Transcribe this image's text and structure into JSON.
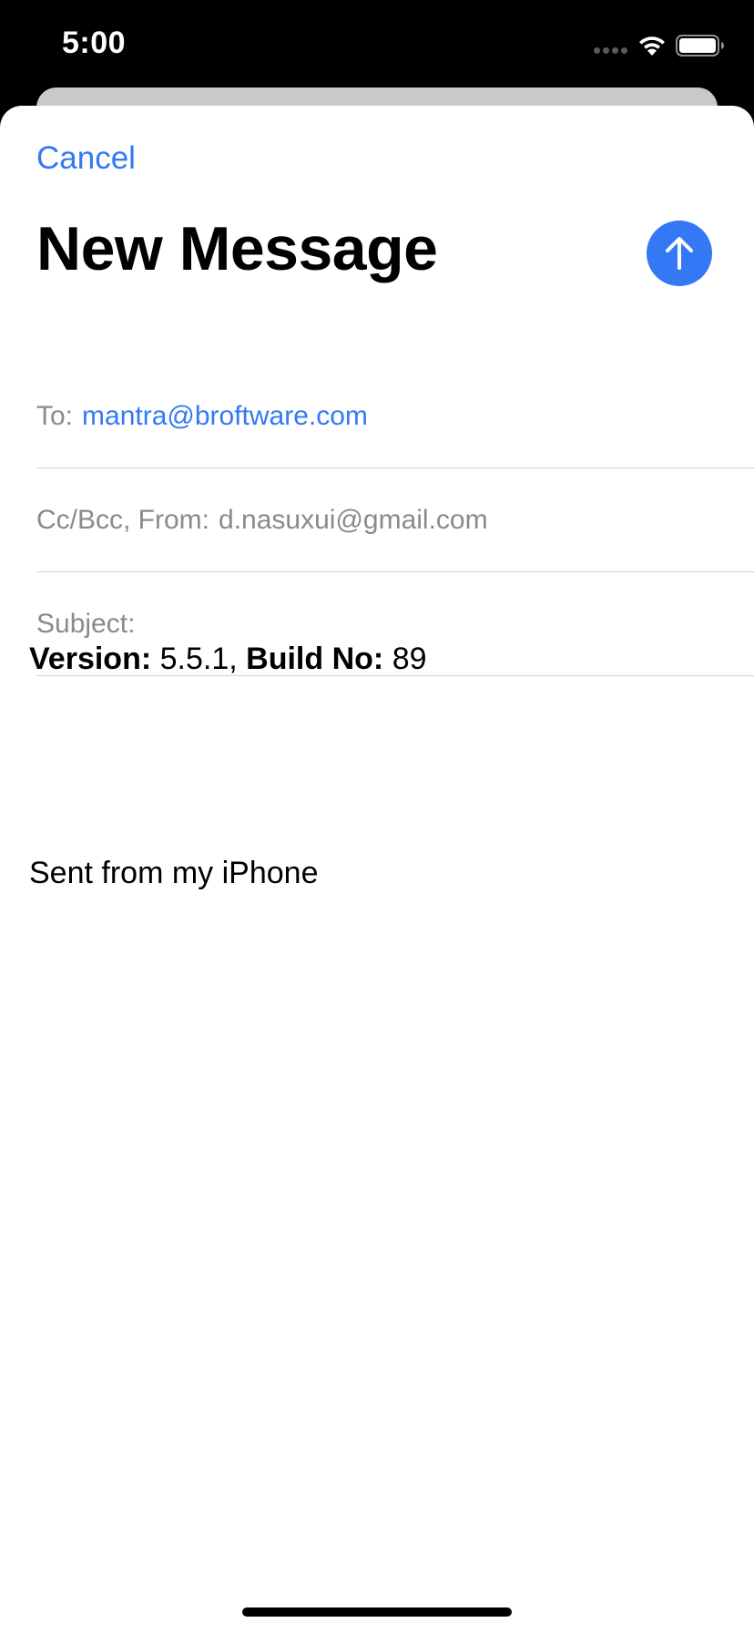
{
  "status_bar": {
    "time": "5:00",
    "icons": [
      "signal-dots-icon",
      "wifi-icon",
      "battery-icon"
    ]
  },
  "compose": {
    "cancel_label": "Cancel",
    "title": "New Message",
    "send_icon": "arrow-up-icon",
    "to": {
      "label": "To:",
      "value": "mantra@broftware.com"
    },
    "cc_from": {
      "label": "Cc/Bcc, From:",
      "value": "d.nasuxui@gmail.com"
    },
    "subject": {
      "label": "Subject:",
      "value": ""
    },
    "body": {
      "version_label": "Version:",
      "version_value": "5.5.1,",
      "build_label": "Build No:",
      "build_value": "89",
      "signature": "Sent from my iPhone"
    }
  },
  "colors": {
    "accent": "#3478f6",
    "secondary_text": "#8a8a8e",
    "separator": "#d1d1d6"
  }
}
